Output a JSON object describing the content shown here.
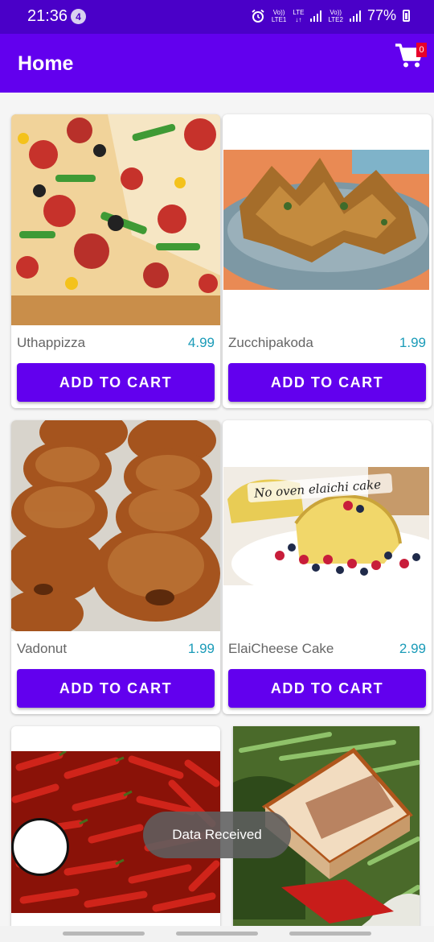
{
  "status_bar": {
    "time": "21:36",
    "notification_count": "4",
    "sim1_label": [
      "Vo))",
      "LTE1"
    ],
    "net_label": [
      "LTE",
      "↓↑"
    ],
    "sim2_label": [
      "Vo))",
      "LTE2"
    ],
    "battery": "77%",
    "icons": [
      "alarm-icon",
      "signal-icon",
      "battery-icon"
    ]
  },
  "app_bar": {
    "title": "Home",
    "cart_icon": "cart-icon",
    "cart_count": "0"
  },
  "colors": {
    "primary": "#6200ee",
    "status_bar": "#4a00c8",
    "price": "#1a9bb8"
  },
  "products": [
    {
      "name": "Uthappizza",
      "price": "4.99",
      "button": "ADD TO CART",
      "image": "pizza"
    },
    {
      "name": "Zucchipakoda",
      "price": "1.99",
      "button": "ADD TO CART",
      "image": "pakoda"
    },
    {
      "name": "Vadonut",
      "price": "1.99",
      "button": "ADD TO CART",
      "image": "donuts"
    },
    {
      "name": "ElaiCheese Cake",
      "price": "2.99",
      "button": "ADD TO CART",
      "image": "cheese-cake",
      "image_caption": "No oven elaichi cake"
    },
    {
      "name": "",
      "price": "",
      "button": "",
      "image": "red-chillies"
    },
    {
      "name": "",
      "price": "",
      "button": "",
      "image": "paneer"
    }
  ],
  "toast": "Data Received"
}
